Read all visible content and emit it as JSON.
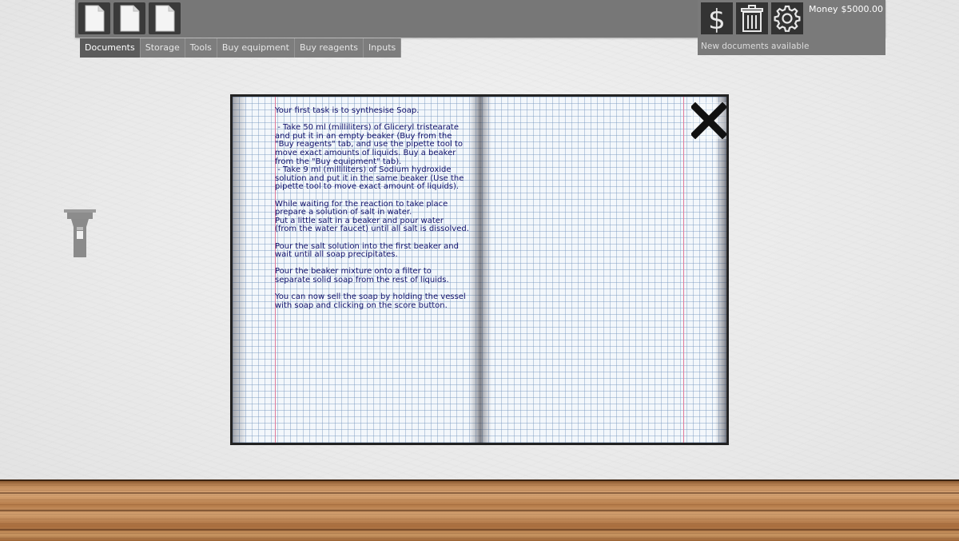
{
  "toolbar": {
    "document_buttons": [
      "document-1",
      "document-2",
      "document-3"
    ],
    "tabs": [
      {
        "label": "Documents",
        "active": true
      },
      {
        "label": "Storage",
        "active": false
      },
      {
        "label": "Tools",
        "active": false
      },
      {
        "label": "Buy equipment",
        "active": false
      },
      {
        "label": "Buy reagents",
        "active": false
      },
      {
        "label": "Inputs",
        "active": false
      }
    ]
  },
  "status": {
    "money_label": "Money",
    "money_value": "$5000.00",
    "notice": "New documents available",
    "icons": [
      "dollar-icon",
      "trash-icon",
      "gear-icon"
    ]
  },
  "notebook": {
    "text": "Your first task is to synthesise Soap.\n\n - Take 50 ml (milliliters) of Gliceryl tristearate\nand put it in an empty beaker (Buy from the\n\"Buy reagents\" tab, and use the pipette tool to\nmove exact amounts of liquids. Buy a beaker\nfrom the \"Buy equipment\" tab).\n - Take 9 ml (milliliters) of Sodium hydroxide\nsolution and put it in the same beaker (Use the\npipette tool to move exact amount of liquids).\n\nWhile waiting for the reaction to take place\nprepare a solution of salt in water.\nPut a little salt in a beaker and pour water\n(from the water faucet) until all salt is dissolved.\n\nPour the salt solution into the first beaker and\nwait until all soap precipitates.\n\nPour the beaker mixture onto a filter to\nseparate solid soap from the rest of liquids.\n\nYou can now sell the soap by holding the vessel\nwith soap and clicking on the score button."
  },
  "colors": {
    "toolbar": "#777777",
    "active_tab": "#5b5b5b",
    "note_text": "#10106a",
    "margin_line": "#e07a9a"
  }
}
